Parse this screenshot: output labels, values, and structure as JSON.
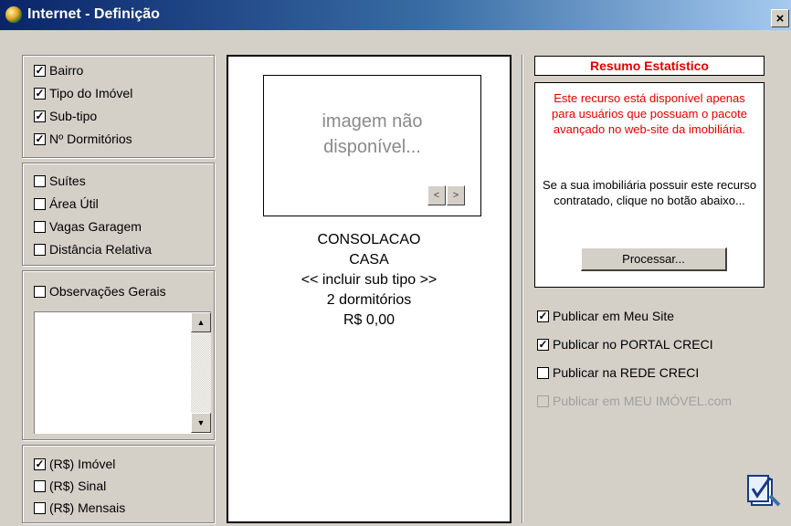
{
  "window": {
    "title": "Internet - Definição",
    "close_label": "×"
  },
  "group1": {
    "items": [
      {
        "label": "Bairro",
        "checked": true
      },
      {
        "label": "Tipo do Imóvel",
        "checked": true
      },
      {
        "label": "Sub-tipo",
        "checked": true
      },
      {
        "label": "Nº Dormitórios",
        "checked": true
      }
    ]
  },
  "group2": {
    "items": [
      {
        "label": "Suítes",
        "checked": false
      },
      {
        "label": "Área Útil",
        "checked": false
      },
      {
        "label": "Vagas Garagem",
        "checked": false
      },
      {
        "label": "Distância Relativa",
        "checked": false
      }
    ]
  },
  "group3": {
    "label": "Observações Gerais",
    "checked": false,
    "text": ""
  },
  "group4": {
    "items": [
      {
        "label": "(R$) Imóvel",
        "checked": true
      },
      {
        "label": "(R$) Sinal",
        "checked": false
      },
      {
        "label": "(R$) Mensais",
        "checked": false
      }
    ]
  },
  "preview": {
    "image_placeholder_line1": "imagem não",
    "image_placeholder_line2": "disponível...",
    "prev_arrow": "<",
    "next_arrow": ">",
    "neighborhood": "CONSOLACAO",
    "type": "CASA",
    "subtype": "<< incluir sub tipo >>",
    "bedrooms": "2 dormitórios",
    "price": "R$ 0,00"
  },
  "stats": {
    "title": "Resumo Estatístico",
    "notice": "Este recurso está disponível apenas para usuários que possuam o pacote avançado no web-site da imobiliária.",
    "instruction": "Se a sua imobiliária possuir este recurso contratado, clique no botão abaixo...",
    "button_label": "Processar..."
  },
  "publish": [
    {
      "label": "Publicar em Meu Site",
      "checked": true,
      "enabled": true
    },
    {
      "label": "Publicar no PORTAL CRECI",
      "checked": true,
      "enabled": true
    },
    {
      "label": "Publicar na REDE CRECI",
      "checked": false,
      "enabled": true
    },
    {
      "label": "Publicar em MEU IMÓVEL.com",
      "checked": false,
      "enabled": false
    }
  ],
  "icons": {
    "title": "globe-icon",
    "confirm": "checkmark-document-icon"
  }
}
